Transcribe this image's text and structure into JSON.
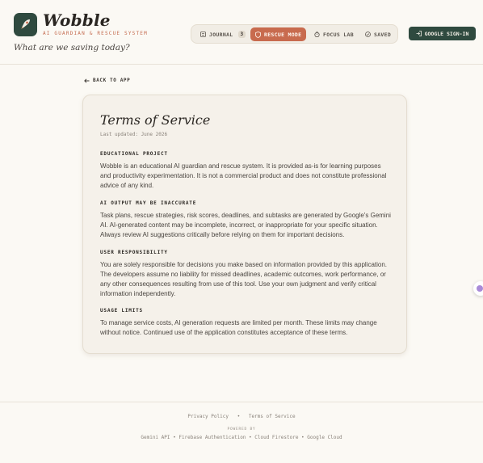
{
  "brand": {
    "title": "Wobble",
    "subtitle": "AI GUARDIAN & RESCUE SYSTEM",
    "tagline": "What are we saving today?"
  },
  "nav": {
    "journal_label": "JOURNAL",
    "journal_count": "3",
    "rescue_label": "RESCUE MODE",
    "focus_label": "FOCUS LAB",
    "saved_label": "SAVED"
  },
  "signin_label": "GOOGLE SIGN-IN",
  "back_label": "BACK TO APP",
  "terms": {
    "title": "Terms of Service",
    "updated": "Last updated: June 2026",
    "sections": [
      {
        "heading": "EDUCATIONAL PROJECT",
        "body": "Wobble is an educational AI guardian and rescue system. It is provided as-is for learning purposes and productivity experimentation. It is not a commercial product and does not constitute professional advice of any kind."
      },
      {
        "heading": "AI OUTPUT MAY BE INACCURATE",
        "body": "Task plans, rescue strategies, risk scores, deadlines, and subtasks are generated by Google's Gemini AI. AI-generated content may be incomplete, incorrect, or inappropriate for your specific situation. Always review AI suggestions critically before relying on them for important decisions."
      },
      {
        "heading": "USER RESPONSIBILITY",
        "body": "You are solely responsible for decisions you make based on information provided by this application. The developers assume no liability for missed deadlines, academic outcomes, work performance, or any other consequences resulting from use of this tool. Use your own judgment and verify critical information independently."
      },
      {
        "heading": "USAGE LIMITS",
        "body": "To manage service costs, AI generation requests are limited per month. These limits may change without notice. Continued use of the application constitutes acceptance of these terms."
      }
    ]
  },
  "footer": {
    "privacy": "Privacy Policy",
    "separator": "•",
    "terms": "Terms of Service",
    "powered_by": "POWERED BY",
    "stack": "Gemini API • Firebase Authentication • Cloud Firestore • Google Cloud"
  },
  "colors": {
    "accent": "#c86b4e",
    "brand_dark": "#2f4a3f",
    "background": "#fbf9f4"
  }
}
